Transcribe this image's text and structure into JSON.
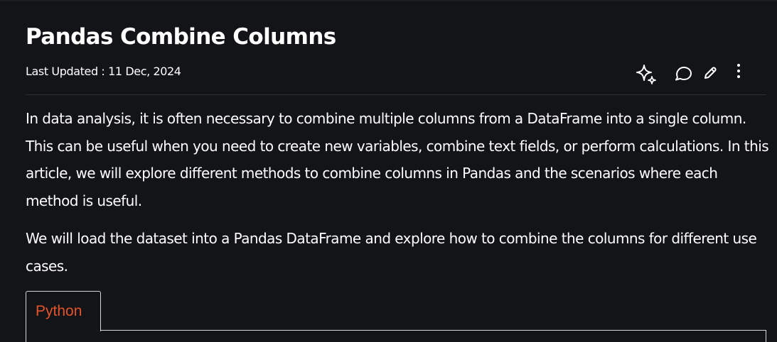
{
  "article": {
    "title": "Pandas Combine Columns",
    "last_updated": "Last Updated : 11 Dec, 2024",
    "paragraphs": [
      "In data analysis, it is often necessary to combine multiple columns from a DataFrame into a single column. This can be useful when you need to create new variables, combine text fields, or perform calculations. In this article, we will explore different methods to combine columns in Pandas and the scenarios where each method is useful.",
      "We will load the dataset into a Pandas DataFrame and explore how to combine the columns for different use cases."
    ]
  },
  "actions": [
    {
      "icon": "sparkle-icon"
    },
    {
      "icon": "comment-icon"
    },
    {
      "icon": "pencil-icon"
    },
    {
      "icon": "more-vertical-icon"
    }
  ],
  "code_block": {
    "tabs": [
      {
        "label": "Python",
        "active": true
      }
    ]
  },
  "colors": {
    "background": "#131417",
    "text": "#ffffff",
    "tab_accent": "#e2542a",
    "border": "#d7d7d7"
  }
}
